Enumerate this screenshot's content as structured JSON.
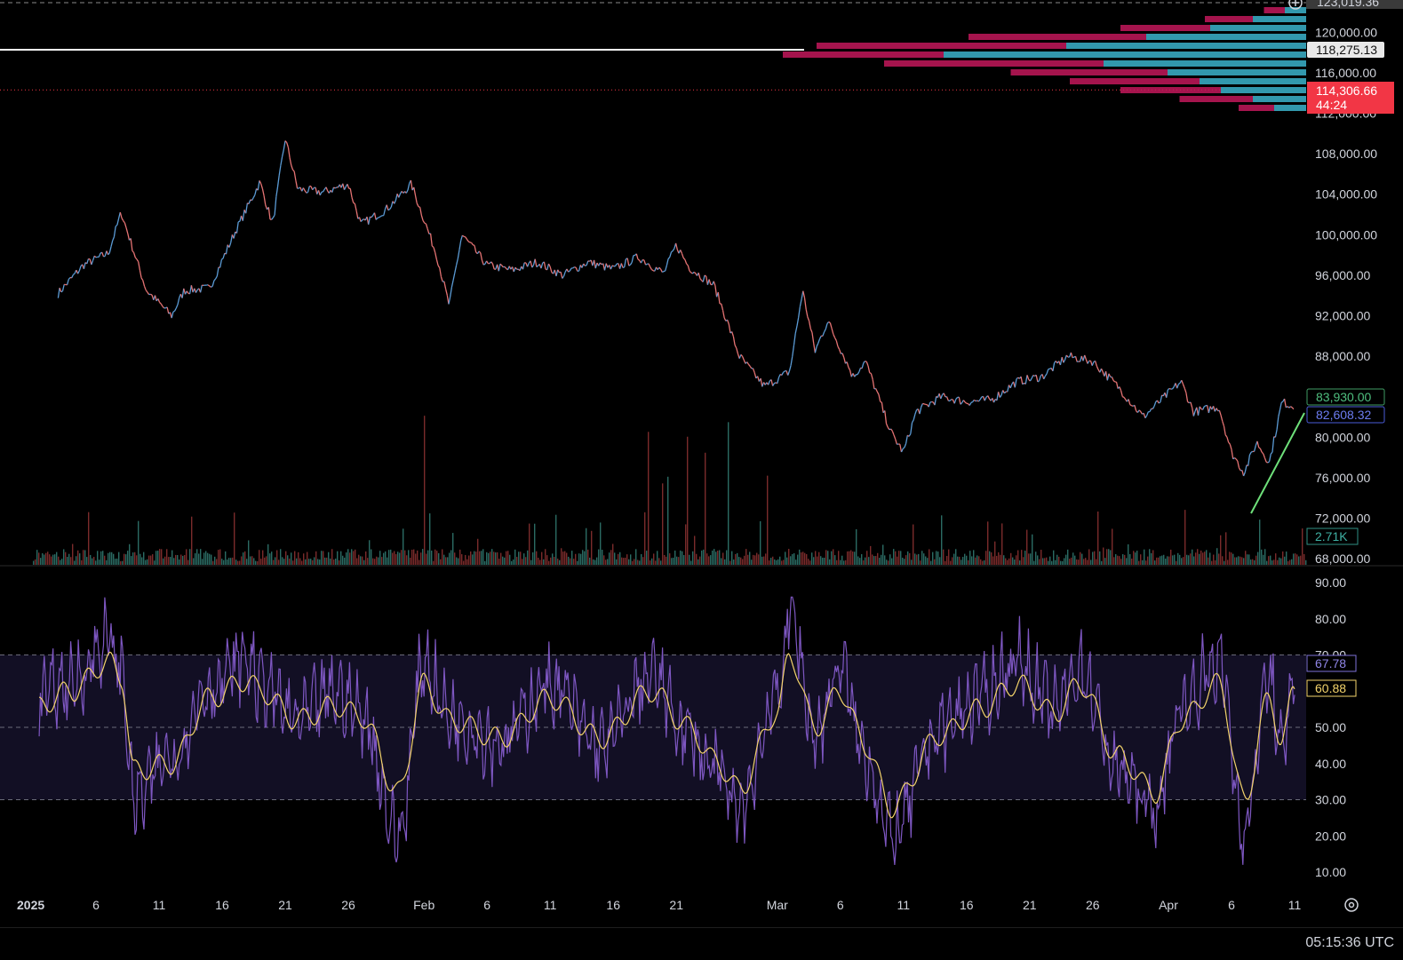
{
  "colors": {
    "background": "#000000",
    "price_up": "#5b9bd5",
    "price_down": "#e57373",
    "rsi_line": "#7e57c2",
    "rsi_ma": "#f3d36b",
    "rsi_band": "#120f24",
    "vp_up": "#26a6b8",
    "vp_down": "#c2185b",
    "trendline": "#6ee07a",
    "last_price_badge": "#f23645",
    "vwap_badge": "#4a5bd8",
    "ma_badge": "#3f9d63",
    "volume_badge": "#2f8f83",
    "rsi_badge": "#7e72d8",
    "rsi_ma_badge": "#f3d36b"
  },
  "icons": {
    "add": "plus-circle-icon",
    "settings": "gear-icon"
  },
  "footer": {
    "utc_time": "05:15:36 UTC"
  },
  "price_axis": {
    "top_label": "123,019.36",
    "ticks": [
      "120,000.00",
      "116,000.00",
      "112,000.00",
      "108,000.00",
      "104,000.00",
      "100,000.00",
      "96,000.00",
      "92,000.00",
      "88,000.00",
      "80,000.00",
      "76,000.00",
      "72,000.00",
      "68,000.00"
    ],
    "tick_values": [
      120000,
      116000,
      112000,
      108000,
      104000,
      100000,
      96000,
      92000,
      88000,
      80000,
      76000,
      72000,
      68000
    ]
  },
  "badges": {
    "hline_price": "118,275.13",
    "last_price": "114,306.66",
    "countdown": "44:24",
    "ma_value": "83,930.00",
    "vwap_value": "82,608.32",
    "volume": "2.71K",
    "rsi_value": "67.78",
    "rsi_ma_value": "60.88"
  },
  "rsi_axis": {
    "ticks": [
      "90.00",
      "80.00",
      "70.00",
      "50.00",
      "40.00",
      "30.00",
      "20.00",
      "10.00"
    ],
    "tick_values": [
      90,
      80,
      70,
      50,
      40,
      30,
      20,
      10
    ],
    "band": [
      30,
      70
    ],
    "midline": 50
  },
  "time_axis": {
    "labels": [
      "2025",
      "6",
      "11",
      "16",
      "21",
      "26",
      "Feb",
      "6",
      "11",
      "16",
      "21",
      "Mar",
      "6",
      "11",
      "16",
      "21",
      "26",
      "Apr",
      "6",
      "11"
    ],
    "days_from_jan1": [
      0,
      5,
      10,
      15,
      20,
      25,
      31,
      36,
      41,
      46,
      51,
      59,
      64,
      69,
      74,
      79,
      84,
      90,
      95,
      100
    ]
  },
  "chart_data": [
    {
      "type": "line",
      "panel": "price",
      "x": [
        "2025-01-03",
        "2025-01-05",
        "2025-01-07",
        "2025-01-08",
        "2025-01-10",
        "2025-01-12",
        "2025-01-13",
        "2025-01-15",
        "2025-01-17",
        "2025-01-19",
        "2025-01-20",
        "2025-01-21",
        "2025-01-22",
        "2025-01-24",
        "2025-01-26",
        "2025-01-27",
        "2025-01-29",
        "2025-01-31",
        "2025-02-02",
        "2025-02-03",
        "2025-02-04",
        "2025-02-06",
        "2025-02-08",
        "2025-02-10",
        "2025-02-12",
        "2025-02-14",
        "2025-02-16",
        "2025-02-18",
        "2025-02-20",
        "2025-02-21",
        "2025-02-22",
        "2025-02-24",
        "2025-02-25",
        "2025-02-26",
        "2025-02-28",
        "2025-03-02",
        "2025-03-03",
        "2025-03-04",
        "2025-03-05",
        "2025-03-07",
        "2025-03-08",
        "2025-03-09",
        "2025-03-10",
        "2025-03-11",
        "2025-03-12",
        "2025-03-14",
        "2025-03-16",
        "2025-03-18",
        "2025-03-20",
        "2025-03-22",
        "2025-03-24",
        "2025-03-26",
        "2025-03-28",
        "2025-03-30",
        "2025-04-02",
        "2025-04-03",
        "2025-04-05",
        "2025-04-06",
        "2025-04-07",
        "2025-04-08",
        "2025-04-09",
        "2025-04-10",
        "2025-04-11"
      ],
      "y": [
        94200,
        97000,
        98200,
        102200,
        94500,
        92000,
        94500,
        94700,
        100200,
        105200,
        101000,
        109500,
        104500,
        104200,
        105000,
        101000,
        102500,
        105000,
        98000,
        93000,
        100000,
        97000,
        96500,
        97300,
        96000,
        97300,
        96600,
        97800,
        96200,
        99000,
        96800,
        95000,
        91500,
        88000,
        85000,
        86500,
        94500,
        88500,
        91500,
        86000,
        87500,
        84000,
        80500,
        78500,
        82500,
        84000,
        83500,
        83700,
        85500,
        86000,
        88000,
        87500,
        85000,
        82000,
        85500,
        82500,
        83000,
        78500,
        76500,
        79500,
        77500,
        83500,
        83000
      ],
      "ylabel": "",
      "xlabel": ""
    },
    {
      "type": "line",
      "panel": "rsi",
      "x": [
        "2025-01-01",
        "2025-01-04",
        "2025-01-07",
        "2025-01-08",
        "2025-01-09",
        "2025-01-12",
        "2025-01-15",
        "2025-01-18",
        "2025-01-19",
        "2025-01-22",
        "2025-01-25",
        "2025-01-27",
        "2025-01-30",
        "2025-02-01",
        "2025-02-03",
        "2025-02-07",
        "2025-02-11",
        "2025-02-15",
        "2025-02-19",
        "2025-02-22",
        "2025-02-24",
        "2025-02-26",
        "2025-03-01",
        "2025-03-02",
        "2025-03-04",
        "2025-03-06",
        "2025-03-08",
        "2025-03-10",
        "2025-03-14",
        "2025-03-17",
        "2025-03-20",
        "2025-03-23",
        "2025-03-25",
        "2025-03-28",
        "2025-03-31",
        "2025-04-02",
        "2025-04-05",
        "2025-04-07",
        "2025-04-09",
        "2025-04-10",
        "2025-04-11"
      ],
      "series": [
        {
          "values": [
            58,
            62,
            74,
            66,
            30,
            42,
            61,
            69,
            62,
            52,
            60,
            54,
            20,
            68,
            53,
            46,
            62,
            45,
            64,
            48,
            38,
            28,
            58,
            82,
            48,
            66,
            42,
            20,
            50,
            58,
            68,
            55,
            66,
            38,
            27,
            56,
            68,
            22,
            64,
            42,
            68
          ]
        },
        {
          "values": [
            55,
            60,
            68,
            64,
            38,
            40,
            58,
            63,
            60,
            52,
            56,
            53,
            32,
            62,
            52,
            47,
            58,
            47,
            60,
            50,
            41,
            33,
            54,
            70,
            50,
            60,
            45,
            28,
            48,
            55,
            62,
            54,
            62,
            42,
            32,
            52,
            62,
            30,
            58,
            46,
            61
          ]
        }
      ],
      "ylim": [
        10,
        90
      ]
    },
    {
      "type": "bar",
      "panel": "volume_profile",
      "categories": [
        "123000",
        "122000",
        "121000",
        "120000",
        "119000",
        "118000",
        "117000",
        "116000",
        "115000",
        "114000",
        "113000",
        "112000"
      ],
      "series": [
        {
          "values": [
            5,
            12,
            22,
            40,
            58,
            62,
            50,
            35,
            28,
            22,
            15,
            8
          ]
        },
        {
          "values": [
            4,
            10,
            18,
            30,
            45,
            68,
            38,
            26,
            20,
            16,
            10,
            6
          ]
        }
      ]
    }
  ]
}
